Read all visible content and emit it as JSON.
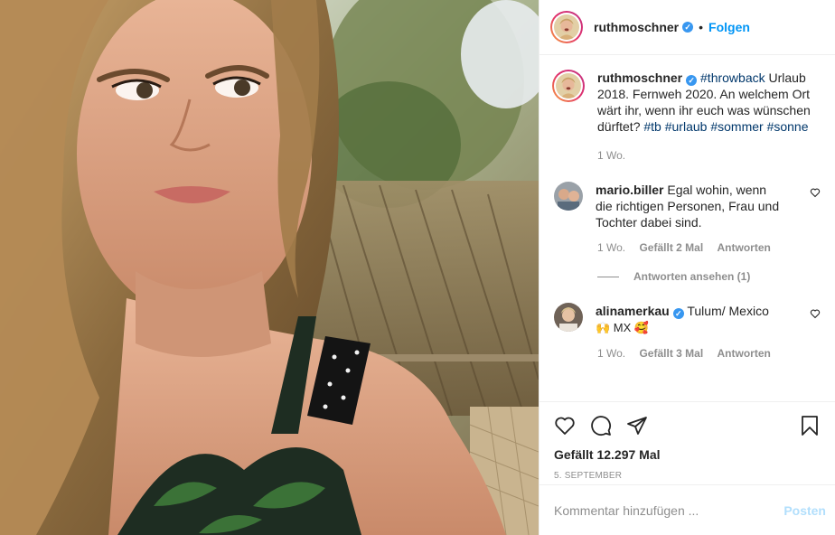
{
  "post": {
    "username": "ruthmoschner",
    "follow_label": "Folgen",
    "dot": "•",
    "verified_glyph": "✓"
  },
  "caption": {
    "username": "ruthmoschner",
    "hashtag_throwback": "#throwback",
    "text_main": " Urlaub 2018. Fernweh 2020. An welchem Ort wärt ihr, wenn ihr euch was wünschen dürftet? ",
    "hashtag_tb": "#tb",
    "hashtag_urlaub": "#urlaub",
    "hashtag_sommer": "#sommer",
    "hashtag_sonne": "#sonne",
    "time": "1 Wo."
  },
  "comments": [
    {
      "username": "mario.biller",
      "text": " Egal wohin, wenn die richtigen Personen, Frau und Tochter dabei sind.",
      "time": "1 Wo.",
      "likes": "Gefällt 2 Mal",
      "reply_label": "Antworten",
      "view_replies": "Antworten ansehen (1)"
    },
    {
      "username": "alinamerkau",
      "text": " Tulum/ Mexico",
      "emoji_line": "🙌 MX 🥰",
      "time": "1 Wo.",
      "likes": "Gefällt 3 Mal",
      "reply_label": "Antworten"
    }
  ],
  "actions": {
    "likes_count": "Gefällt 12.297 Mal",
    "date": "5. SEPTEMBER"
  },
  "add_comment": {
    "placeholder": "Kommentar hinzufügen ...",
    "post_label": "Posten"
  },
  "colors": {
    "accent": "#0095f6",
    "link": "#00376b",
    "muted": "#8e8e8e",
    "verified": "#3897f0"
  },
  "icons": [
    "heart-icon",
    "comment-icon",
    "share-icon",
    "bookmark-icon"
  ]
}
